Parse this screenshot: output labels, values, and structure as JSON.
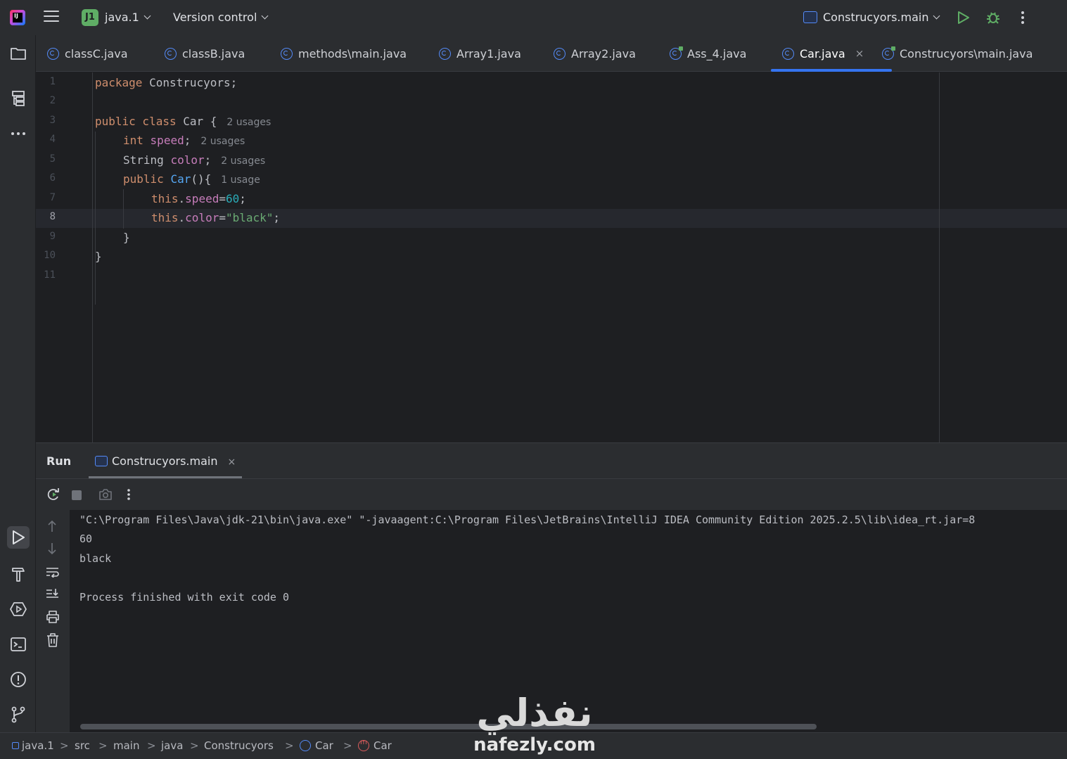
{
  "topbar": {
    "project_badge": "J1",
    "project_name": "java.1",
    "vcs_label": "Version control",
    "run_config": "Construcyors.main"
  },
  "tabs": [
    {
      "label": "classC.java"
    },
    {
      "label": "classB.java"
    },
    {
      "label": "methods\\main.java"
    },
    {
      "label": "Array1.java"
    },
    {
      "label": "Array2.java"
    },
    {
      "label": "Ass_4.java"
    },
    {
      "label": "Car.java",
      "close": "×"
    },
    {
      "label": "Construcyors\\main.java"
    }
  ],
  "editor": {
    "line_numbers": [
      "1",
      "2",
      "3",
      "4",
      "5",
      "6",
      "7",
      "8",
      "9",
      "10",
      "11"
    ],
    "current_line": "8",
    "lines": {
      "l1_kw": "package",
      "l1_rest": " Construcyors;",
      "l3_kw": "public class",
      "l3_rest": " Car {",
      "l3_hint": "2 usages",
      "l4_kw": "int",
      "l4_fld": "speed",
      "l4_semi": ";",
      "l4_hint": "2 usages",
      "l5_type": "String ",
      "l5_fld": "color",
      "l5_semi": ";",
      "l5_hint": "2 usages",
      "l6_kw": "public",
      "l6_fn": "Car",
      "l6_rest": "(){",
      "l6_hint": "1 usage",
      "l7_kw": "this",
      "l7_dot": ".",
      "l7_fld": "speed",
      "l7_eq": "=",
      "l7_num": "60",
      "l7_semi": ";",
      "l8_kw": "this",
      "l8_dot": ".",
      "l8_fld": "color",
      "l8_eq": "=",
      "l8_str": "\"black\"",
      "l8_semi": ";",
      "l9": "}",
      "l10": "}"
    }
  },
  "run_panel": {
    "title": "Run",
    "tab_label": "Construcyors.main",
    "tab_close": "×",
    "output": [
      "\"C:\\Program Files\\Java\\jdk-21\\bin\\java.exe\" \"-javaagent:C:\\Program Files\\JetBrains\\IntelliJ IDEA Community Edition 2025.2.5\\lib\\idea_rt.jar=8",
      "60",
      "black",
      "",
      "Process finished with exit code 0"
    ]
  },
  "statusbar": {
    "crumbs": [
      "java.1",
      "src",
      "main",
      "java",
      "Construcyors",
      "Car",
      "Car"
    ],
    "sep": ">"
  },
  "watermark": {
    "arabic": "نفذلي",
    "latin": "nafezly.com"
  },
  "icons": {
    "top": [
      "app-logo-icon",
      "hamburger-menu-icon",
      "chevron-down-icon",
      "run-config-icon",
      "run-icon",
      "debug-icon",
      "more-vertical-icon"
    ],
    "left": [
      "project-folder-icon",
      "structure-icon",
      "more-horizontal-icon",
      "run-tool-icon",
      "build-hammer-icon",
      "services-icon",
      "terminal-icon",
      "problems-icon",
      "git-icon"
    ],
    "run_toolbar": [
      "rerun-icon",
      "stop-icon",
      "camera-icon",
      "more-vertical-icon"
    ],
    "console_side": [
      "scroll-up-icon",
      "scroll-down-icon",
      "soft-wrap-icon",
      "scroll-to-end-icon",
      "print-icon",
      "trash-icon"
    ]
  },
  "colors": {
    "accent": "#3574f0",
    "keyword": "#cf8e6d",
    "field": "#c77dbb",
    "function": "#56a8f5",
    "number": "#2aacb8",
    "string": "#6aab73",
    "run_green": "#5fad65"
  }
}
